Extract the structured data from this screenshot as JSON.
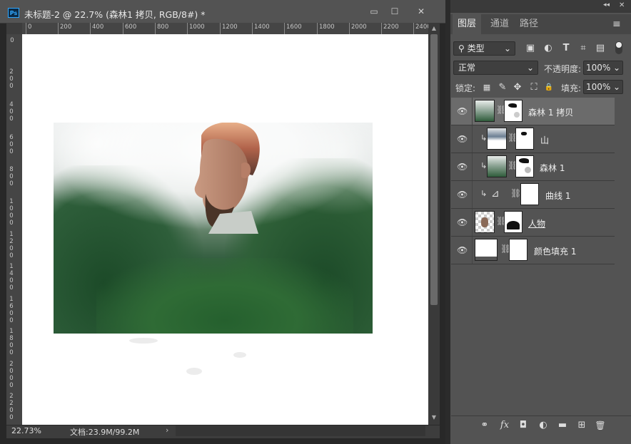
{
  "document": {
    "app_badge": "Ps",
    "title": "未标题-2 @ 22.7% (森林1 拷贝, RGB/8#) *",
    "window_controls": {
      "minimize": "▭",
      "restore": "☐",
      "close": "✕"
    },
    "ruler_h_labels": [
      "0",
      "200",
      "400",
      "600",
      "800",
      "1000",
      "1200",
      "1400",
      "1600",
      "1800",
      "2000",
      "2200",
      "2400"
    ],
    "ruler_v_labels": [
      "0",
      "200",
      "400",
      "600",
      "800",
      "1000",
      "1200",
      "1400",
      "1600",
      "1800",
      "2000",
      "2200"
    ],
    "zoom": "22.73%",
    "doc_info": "文档:23.9M/99.2M",
    "status_arrow": "›"
  },
  "panel": {
    "collapse_icon": "◂◂",
    "close_icon": "✕",
    "tabs": [
      "图层",
      "通道",
      "路径"
    ],
    "menu_icon": "≡",
    "filter": {
      "label": "类型",
      "search_icon": "⚲",
      "arrow": "⌄"
    },
    "filter_icons": [
      "▣",
      "◐",
      "T",
      "⌗",
      "▤"
    ],
    "blend_mode": "正常",
    "opacity_label": "不透明度:",
    "opacity_value": "100%",
    "lock_label": "锁定:",
    "lock_icons": [
      "▦",
      "✎",
      "✥",
      "⛶",
      "🔒"
    ],
    "fill_label": "填充:",
    "fill_value": "100%",
    "layers": [
      {
        "name": "森林 1 拷贝",
        "selected": true,
        "clipped": false
      },
      {
        "name": "山",
        "selected": false,
        "clipped": true
      },
      {
        "name": "森林 1",
        "selected": false,
        "clipped": true
      },
      {
        "name": "曲线 1",
        "selected": false,
        "clipped": true
      },
      {
        "name": "人物",
        "selected": false,
        "clipped": false
      },
      {
        "name": "颜色填充 1",
        "selected": false,
        "clipped": false
      }
    ],
    "bottom_icons": {
      "link": "⚭",
      "fx": "fx",
      "mask": "◘",
      "adjust": "◐",
      "group": "▬",
      "new": "⊞",
      "delete": "🗑"
    }
  },
  "colors": {
    "accent": "#31a8ff",
    "panel_bg": "#535353",
    "selected_layer": "#6b6b6b"
  }
}
